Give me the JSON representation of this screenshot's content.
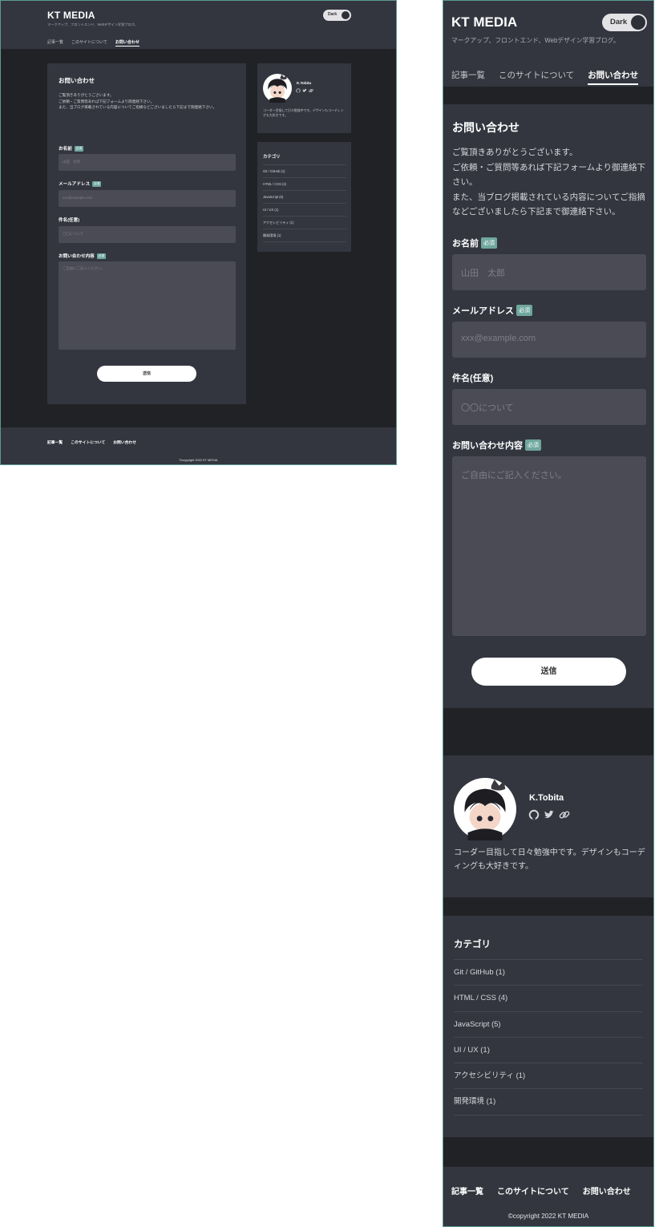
{
  "site": {
    "logo": "KT MEDIA",
    "tagline": "マークアップ、フロントエンド、Webデザイン学習ブログ。",
    "theme_toggle_label": "Dark"
  },
  "nav": {
    "items": [
      {
        "label": "記事一覧"
      },
      {
        "label": "このサイトについて"
      },
      {
        "label": "お問い合わせ"
      }
    ],
    "active_index": 2
  },
  "contact": {
    "title": "お問い合わせ",
    "intro_desktop": [
      "ご覧頂きありがとうございます。",
      "ご依頼・ご質問等あれば下記フォームより御連絡下さい。",
      "また、当ブログ掲載されている内容についてご指摘などございましたら下記まで御連絡下さい。"
    ],
    "intro_mobile": [
      "ご覧頂きありがとうございます。",
      "ご依頼・ご質問等あれば下記フォームより御連絡下さい。",
      "また、当ブログ掲載されている内容についてご指摘などございましたら下記まで御連絡下さい。"
    ],
    "required_badge": "必須",
    "fields": {
      "name": {
        "label": "お名前",
        "placeholder": "山田　太郎"
      },
      "email": {
        "label": "メールアドレス",
        "placeholder": "xxx@example.com"
      },
      "subject": {
        "label": "件名(任意)",
        "placeholder": "〇〇について"
      },
      "message": {
        "label": "お問い合わせ内容",
        "placeholder": "ご自由にご記入ください。"
      }
    },
    "submit_label": "送信"
  },
  "profile": {
    "name": "K.Tobita",
    "bio": "コーダー目指して日々勉強中です。デザインもコーディングも大好きです。",
    "social_icons": [
      "github-icon",
      "twitter-icon",
      "link-icon"
    ]
  },
  "categories": {
    "title": "カテゴリ",
    "items": [
      {
        "label": "Git / GitHub (1)"
      },
      {
        "label": "HTML / CSS (4)"
      },
      {
        "label": "JavaScript (5)"
      },
      {
        "label": "UI / UX (1)"
      },
      {
        "label": "アクセシビリティ (1)"
      },
      {
        "label": "開発環境 (1)"
      }
    ]
  },
  "footer": {
    "copyright": "©copyright 2022 KT MEDIA"
  },
  "colors": {
    "background": "#212226",
    "surface": "#33363f",
    "input": "#4a4b55",
    "accent_badge": "#6fa79f",
    "frame_border": "#5a9a93"
  }
}
